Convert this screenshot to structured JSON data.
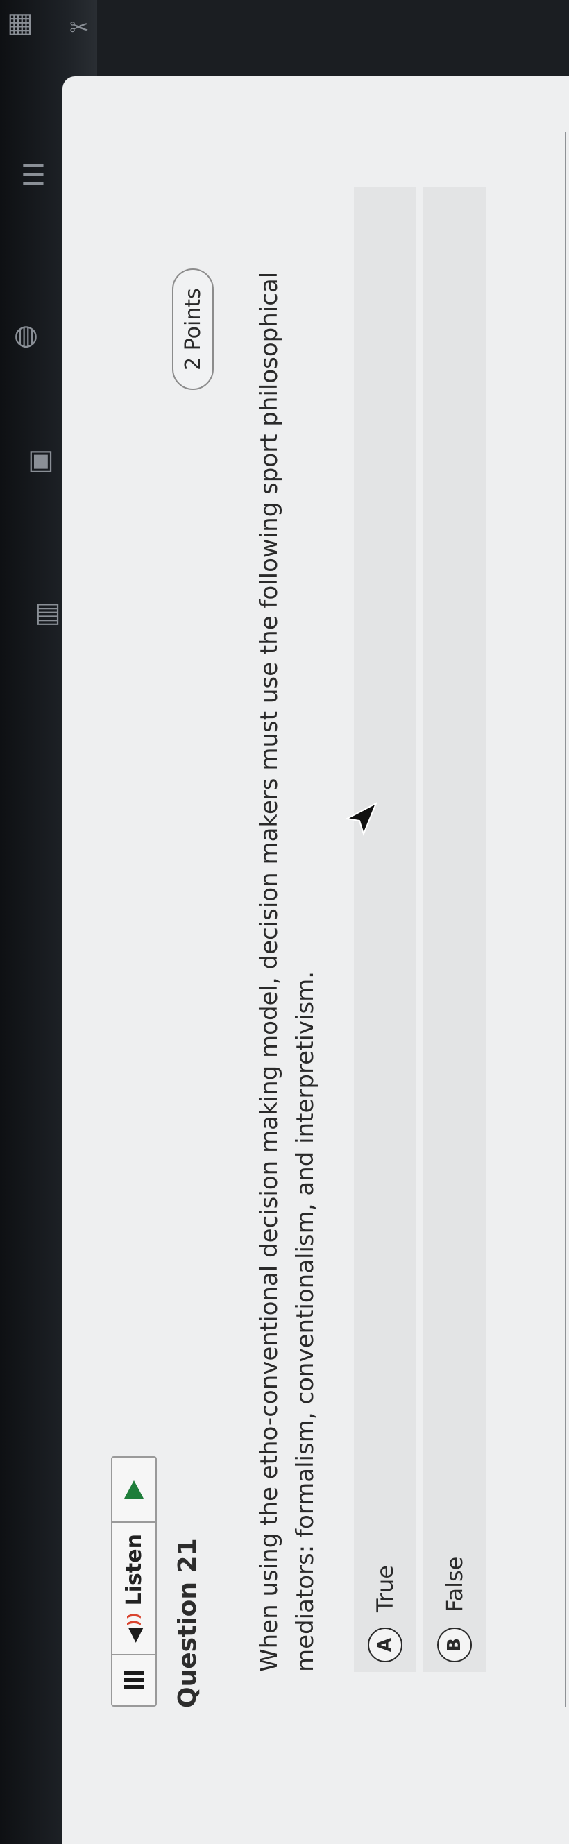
{
  "toolbar": {
    "listen_label": "Listen",
    "icons": [
      "grid-icon",
      "bookmark-icon",
      "calculator-icon",
      "notes-icon",
      "globe-icon",
      "tools-icon",
      "image-icon",
      "pencil-icon",
      "sigma-icon",
      "chart-icon"
    ]
  },
  "question": {
    "title": "Question 21",
    "points": "2 Points",
    "text": "When using the etho-conventional decision making model, decision makers must use the following sport philosophical mediators: formalism, conventionalism, and interpretivism."
  },
  "answers": [
    {
      "letter": "A",
      "label": "True"
    },
    {
      "letter": "B",
      "label": "False"
    }
  ],
  "colors": {
    "play_green": "#1e7d3a",
    "speaker_wave_orange": "#d9442f",
    "page_bg": "#eeeff0",
    "answer_bg": "#e3e4e5"
  }
}
